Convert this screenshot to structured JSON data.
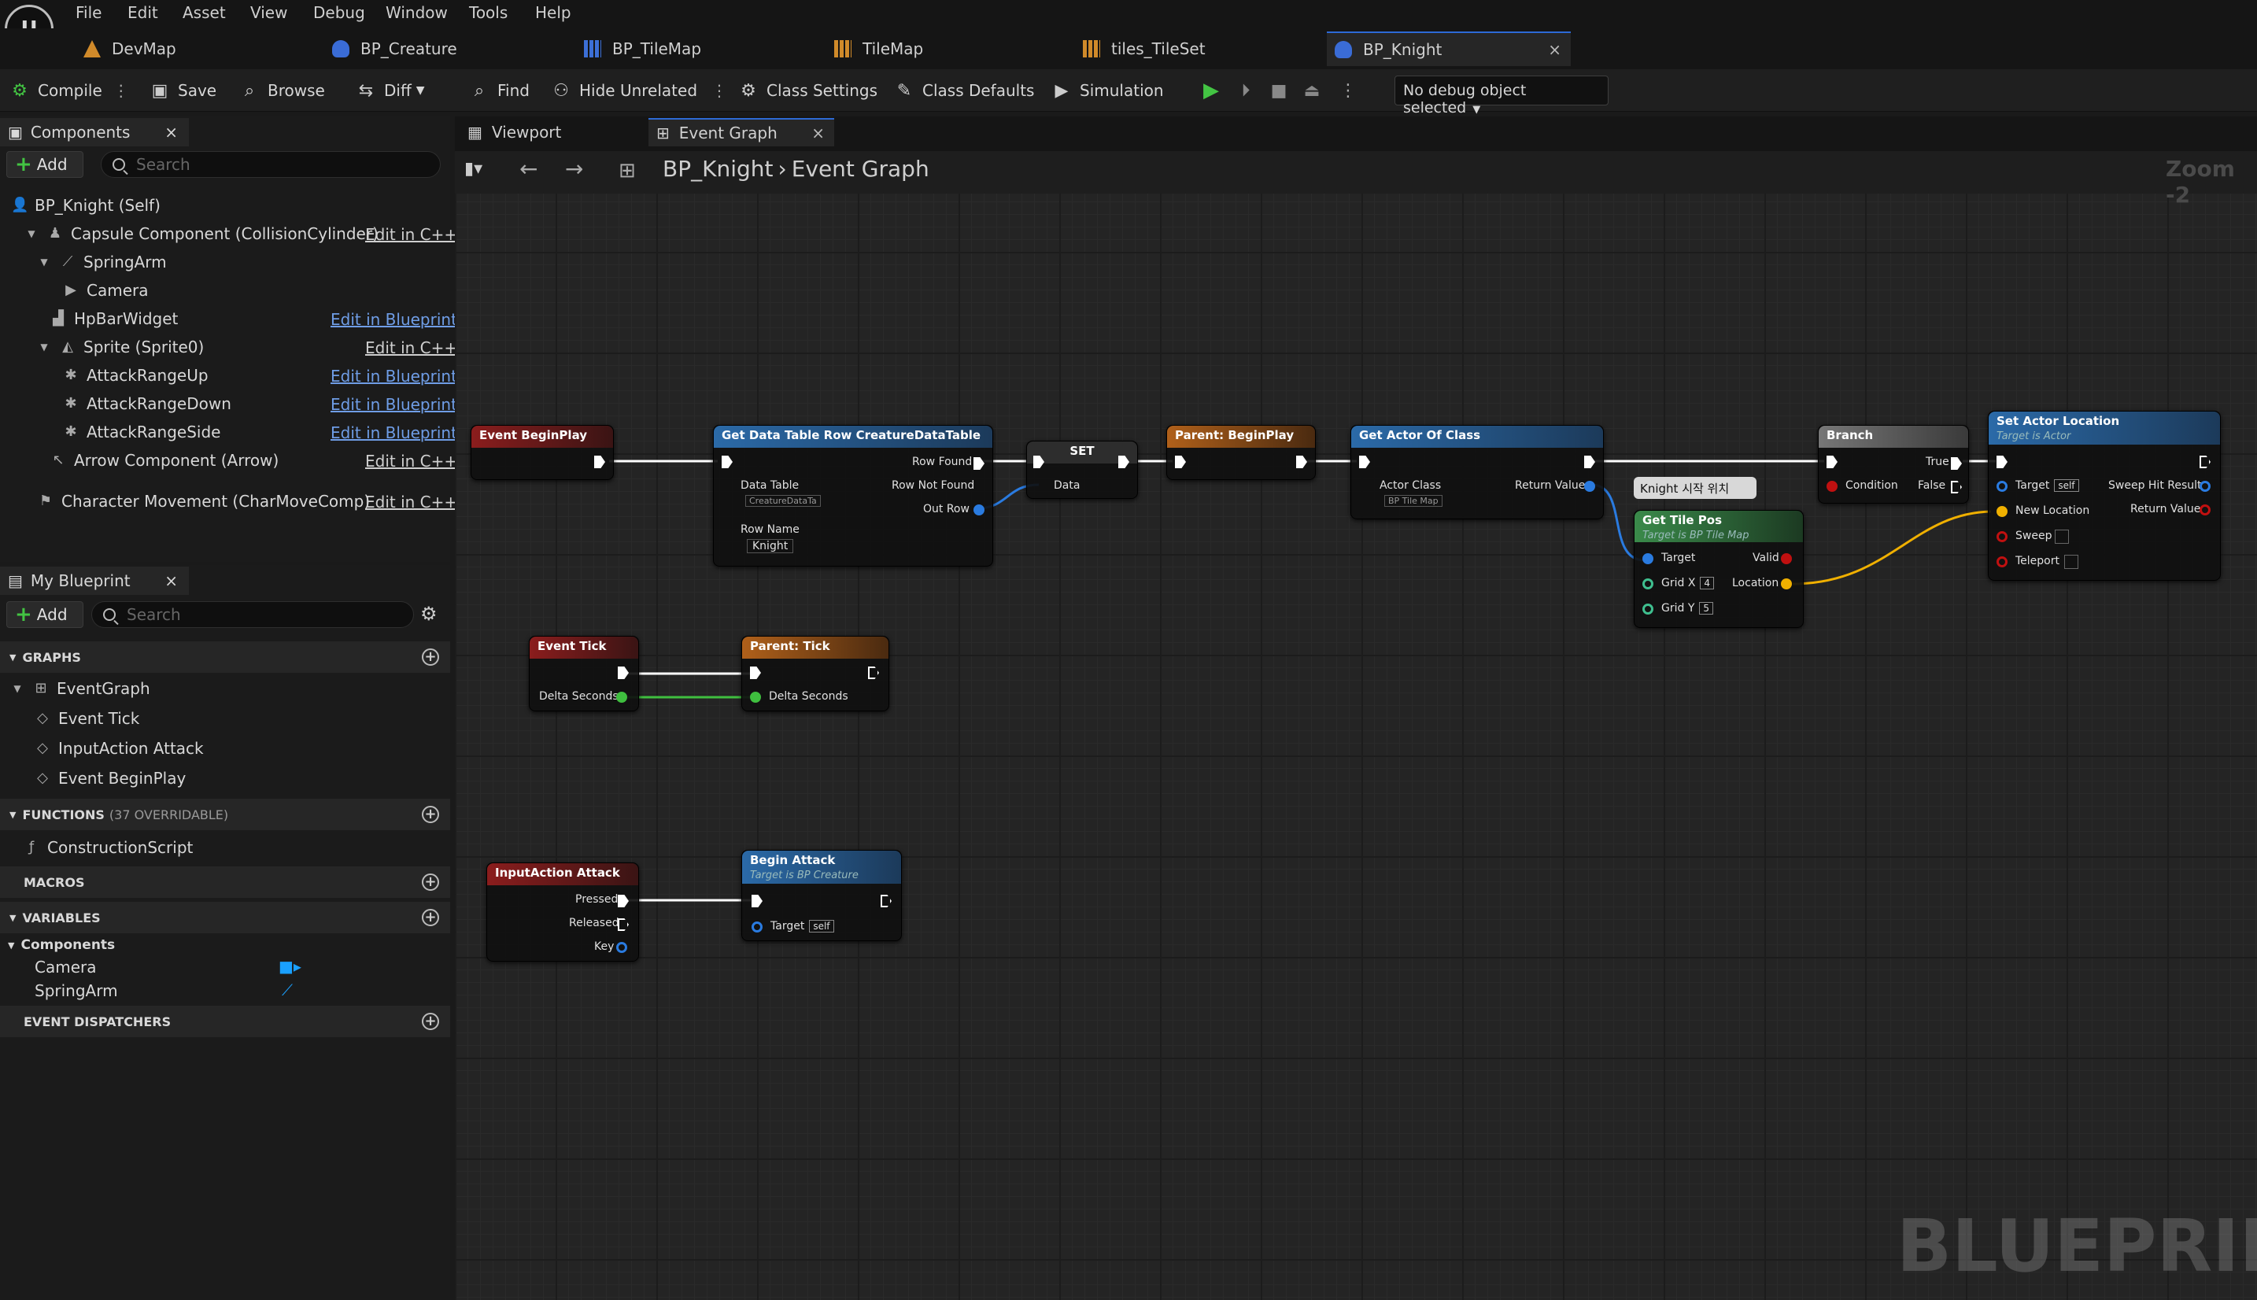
{
  "menu": [
    "File",
    "Edit",
    "Asset",
    "View",
    "Debug",
    "Window",
    "Tools",
    "Help"
  ],
  "logo_icon": "unreal-logo-icon",
  "doc_tabs": [
    {
      "label": "DevMap",
      "icon": "map-icon"
    },
    {
      "label": "BP_Creature",
      "icon": "blueprint-icon"
    },
    {
      "label": "BP_TileMap",
      "icon": "tilemap-icon"
    },
    {
      "label": "TileMap",
      "icon": "tilemap-icon"
    },
    {
      "label": "tiles_TileSet",
      "icon": "tileset-icon"
    },
    {
      "label": "BP_Knight",
      "icon": "blueprint-icon",
      "active": true
    }
  ],
  "toolbar": {
    "compile": "Compile",
    "save": "Save",
    "browse": "Browse",
    "diff": "Diff",
    "find": "Find",
    "hide_unrelated": "Hide Unrelated",
    "class_settings": "Class Settings",
    "class_defaults": "Class Defaults",
    "simulation": "Simulation",
    "debug_object": "No debug object selected"
  },
  "components_panel": {
    "title": "Components",
    "add": "Add",
    "search_placeholder": "Search",
    "items": [
      {
        "label": "BP_Knight (Self)",
        "action": ""
      },
      {
        "label": "Capsule Component (CollisionCylinder)",
        "action": "Edit in C++"
      },
      {
        "label": "SpringArm",
        "action": ""
      },
      {
        "label": "Camera",
        "action": ""
      },
      {
        "label": "HpBarWidget",
        "action": "Edit in Blueprint"
      },
      {
        "label": "Sprite (Sprite0)",
        "action": "Edit in C++"
      },
      {
        "label": "AttackRangeUp",
        "action": "Edit in Blueprint"
      },
      {
        "label": "AttackRangeDown",
        "action": "Edit in Blueprint"
      },
      {
        "label": "AttackRangeSide",
        "action": "Edit in Blueprint"
      },
      {
        "label": "Arrow Component (Arrow)",
        "action": "Edit in C++"
      },
      {
        "label": "Character Movement (CharMoveComp)",
        "action": "Edit in C++"
      }
    ]
  },
  "my_blueprint": {
    "title": "My Blueprint",
    "add": "Add",
    "search_placeholder": "Search",
    "graphs_label": "GRAPHS",
    "event_graph": "EventGraph",
    "events": [
      "Event Tick",
      "InputAction Attack",
      "Event BeginPlay"
    ],
    "functions_label": "FUNCTIONS",
    "functions_count": "(37 OVERRIDABLE)",
    "construction": "ConstructionScript",
    "macros_label": "MACROS",
    "variables_label": "VARIABLES",
    "components_label": "Components",
    "variables": [
      "Camera",
      "SpringArm"
    ],
    "dispatchers_label": "EVENT DISPATCHERS"
  },
  "graph_tabs": {
    "viewport": "Viewport",
    "event_graph": "Event Graph"
  },
  "breadcrumb": {
    "root": "BP_Knight",
    "child": "Event Graph"
  },
  "zoom": "Zoom -2",
  "watermark": "BLUEPRINT",
  "nodes": {
    "event_beginplay": "Event BeginPlay",
    "get_dt_row": "Get Data Table Row CreatureDataTable",
    "data_table": "Data Table",
    "data_table_value": "CreatureDataTa",
    "row_name": "Row Name",
    "row_name_value": "Knight",
    "row_found": "Row Found",
    "row_not_found": "Row Not Found",
    "out_row": "Out Row",
    "set": "SET",
    "data": "Data",
    "parent_beginplay": "Parent: BeginPlay",
    "get_actor_of_class": "Get Actor Of Class",
    "actor_class": "Actor Class",
    "actor_class_value": "BP Tile Map",
    "return_value": "Return Value",
    "branch": "Branch",
    "condition": "Condition",
    "true": "True",
    "false": "False",
    "comment": "Knight 시작 위치",
    "get_tile_pos": "Get Tile Pos",
    "get_tile_pos_sub": "Target is BP Tile Map",
    "target": "Target",
    "valid": "Valid",
    "grid_x": "Grid X",
    "grid_x_value": "4",
    "grid_y": "Grid Y",
    "grid_y_value": "5",
    "location": "Location",
    "set_actor_location": "Set Actor Location",
    "set_actor_location_sub": "Target is Actor",
    "self": "self",
    "new_location": "New Location",
    "sweep": "Sweep",
    "teleport": "Teleport",
    "sweep_hit": "Sweep Hit Result",
    "event_tick": "Event Tick",
    "delta_seconds": "Delta Seconds",
    "parent_tick": "Parent: Tick",
    "input_attack": "InputAction Attack",
    "pressed": "Pressed",
    "released": "Released",
    "key": "Key",
    "begin_attack": "Begin Attack",
    "begin_attack_sub": "Target is BP Creature"
  }
}
